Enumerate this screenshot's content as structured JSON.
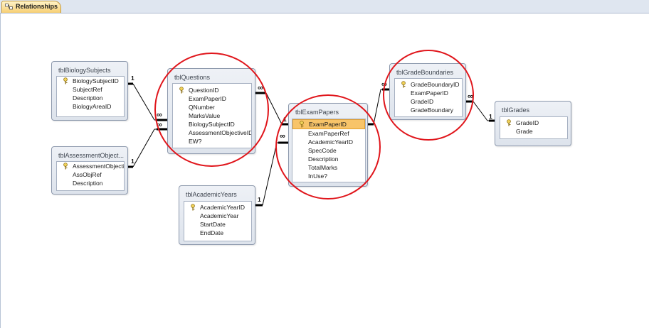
{
  "tab": {
    "label": "Relationships"
  },
  "tables": {
    "biology": {
      "title": "tblBiologySubjects",
      "fields": [
        "BiologySubjectID",
        "SubjectRef",
        "Description",
        "BiologyAreaID"
      ]
    },
    "assessment": {
      "title": "tblAssessmentObject...",
      "fields": [
        "AssessmentObjectiv",
        "AssObjRef",
        "Description"
      ]
    },
    "questions": {
      "title": "tblQuestions",
      "fields": [
        "QuestionID",
        "ExamPaperID",
        "QNumber",
        "MarksValue",
        "BiologySubjectID",
        "AssessmentObjectiveID",
        "EW?"
      ]
    },
    "academic": {
      "title": "tblAcademicYears",
      "fields": [
        "AcademicYearID",
        "AcademicYear",
        "StartDate",
        "EndDate"
      ]
    },
    "exam": {
      "title": "tblExamPapers",
      "fields": [
        "ExamPaperID",
        "ExamPaperRef",
        "AcademicYearID",
        "SpecCode",
        "Description",
        "TotalMarks",
        "InUse?"
      ]
    },
    "boundaries": {
      "title": "tblGradeBoundaries",
      "fields": [
        "GradeBoundaryID",
        "ExamPaperID",
        "GradeID",
        "GradeBoundary"
      ]
    },
    "grades": {
      "title": "tblGrades",
      "fields": [
        "GradeID",
        "Grade"
      ]
    }
  },
  "cardinality": {
    "one": "1",
    "many": "∞"
  },
  "colors": {
    "annotation": "#e0151b",
    "selection": "#f8c469",
    "line": "#000000"
  }
}
